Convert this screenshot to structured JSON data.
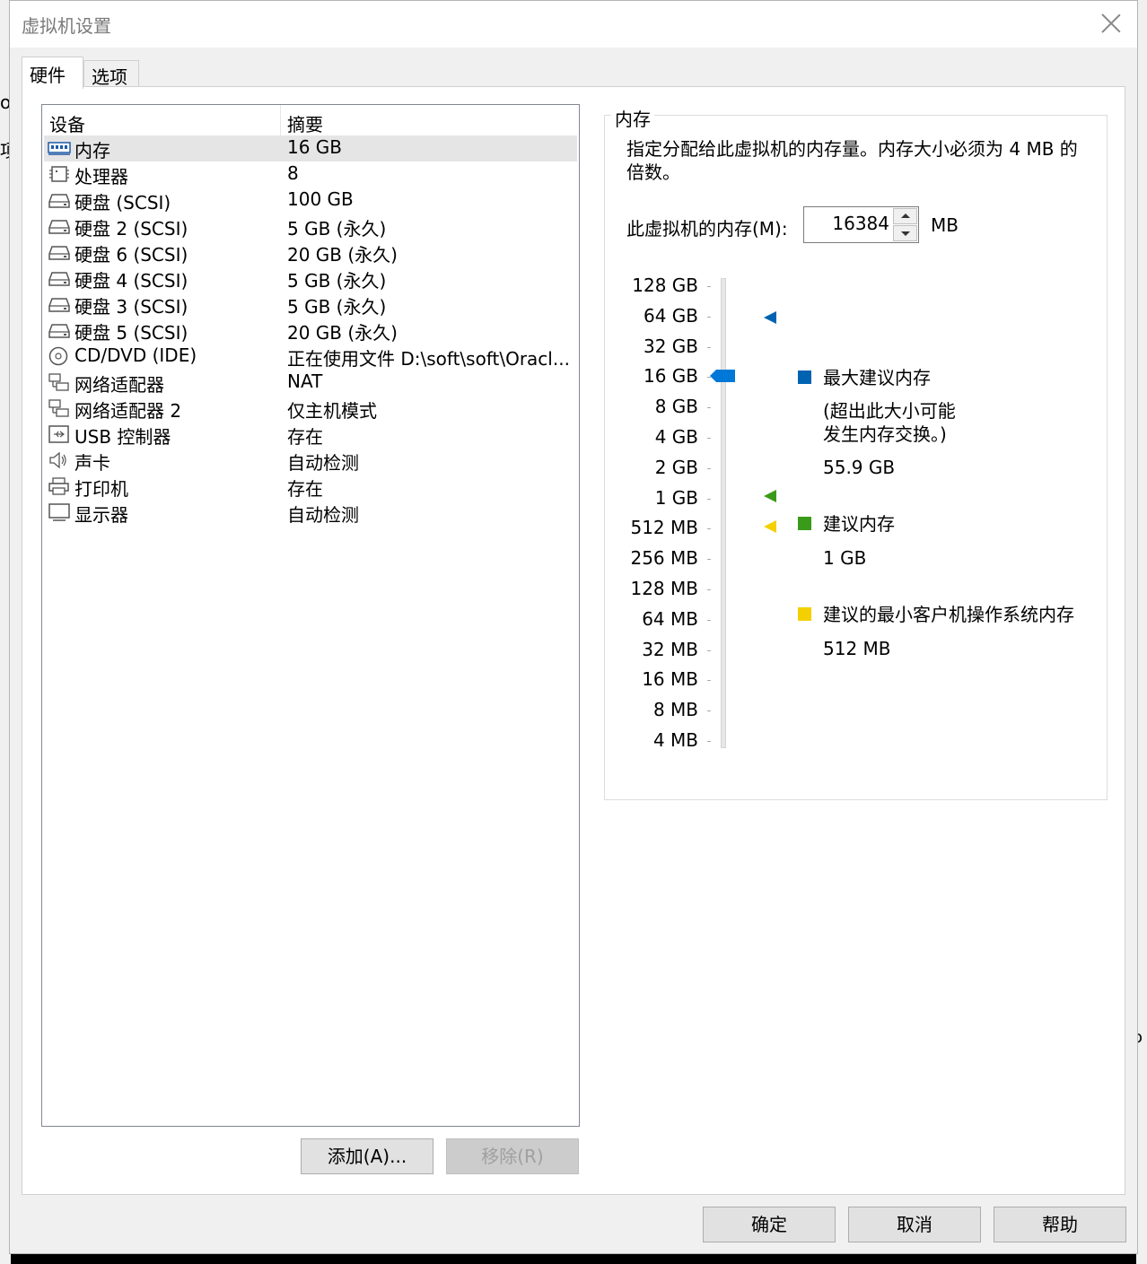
{
  "dialog": {
    "title": "虚拟机设置",
    "tabs": [
      {
        "label": "硬件"
      },
      {
        "label": "选项"
      }
    ]
  },
  "background": {
    "left_chars": [
      "o",
      "项"
    ],
    "right_char": "o"
  },
  "device_list": {
    "headers": {
      "device": "设备",
      "summary": "摘要"
    },
    "rows": [
      {
        "name": "内存",
        "summary": "16 GB",
        "icon": "memory-icon",
        "selected": true
      },
      {
        "name": "处理器",
        "summary": "8",
        "icon": "processor-icon"
      },
      {
        "name": "硬盘 (SCSI)",
        "summary": "100 GB",
        "icon": "hard-disk-icon"
      },
      {
        "name": "硬盘 2 (SCSI)",
        "summary": "5 GB (永久)",
        "icon": "hard-disk-icon"
      },
      {
        "name": "硬盘 6 (SCSI)",
        "summary": "20 GB (永久)",
        "icon": "hard-disk-icon"
      },
      {
        "name": "硬盘 4 (SCSI)",
        "summary": "5 GB (永久)",
        "icon": "hard-disk-icon"
      },
      {
        "name": "硬盘 3 (SCSI)",
        "summary": "5 GB (永久)",
        "icon": "hard-disk-icon"
      },
      {
        "name": "硬盘 5 (SCSI)",
        "summary": "20 GB (永久)",
        "icon": "hard-disk-icon"
      },
      {
        "name": "CD/DVD (IDE)",
        "summary": "正在使用文件 D:\\soft\\soft\\Oracl...",
        "icon": "cd-dvd-icon"
      },
      {
        "name": "网络适配器",
        "summary": "NAT",
        "icon": "network-adapter-icon"
      },
      {
        "name": "网络适配器 2",
        "summary": "仅主机模式",
        "icon": "network-adapter-icon"
      },
      {
        "name": "USB 控制器",
        "summary": "存在",
        "icon": "usb-icon"
      },
      {
        "name": "声卡",
        "summary": "自动检测",
        "icon": "speaker-icon"
      },
      {
        "name": "打印机",
        "summary": "存在",
        "icon": "printer-icon"
      },
      {
        "name": "显示器",
        "summary": "自动检测",
        "icon": "monitor-icon"
      }
    ],
    "add_button": "添加(A)...",
    "remove_button": "移除(R)"
  },
  "memory": {
    "group_title": "内存",
    "description": "指定分配给此虚拟机的内存量。内存大小必须为 4 MB 的倍数。",
    "label": "此虚拟机的内存(M):",
    "value": "16384",
    "unit": "MB",
    "scale": [
      "128 GB",
      "64 GB",
      "32 GB",
      "16 GB",
      "8 GB",
      "4 GB",
      "2 GB",
      "1 GB",
      "512 MB",
      "256 MB",
      "128 MB",
      "64 MB",
      "32 MB",
      "16 MB",
      "8 MB",
      "4 MB"
    ],
    "slider_value": "16 GB",
    "legend": {
      "max": {
        "label": "最大建议内存",
        "note": "(超出此大小可能\n发生内存交换。)",
        "value": "55.9 GB",
        "color": "#0063b1"
      },
      "recommended": {
        "label": "建议内存",
        "value": "1 GB",
        "color": "#3a9a1a"
      },
      "min_guest": {
        "label": "建议的最小客户机操作系统内存",
        "value": "512 MB",
        "color": "#f4d000"
      }
    }
  },
  "footer": {
    "ok": "确定",
    "cancel": "取消",
    "help": "帮助"
  },
  "colors": {
    "slider_thumb": "#0078d7"
  }
}
